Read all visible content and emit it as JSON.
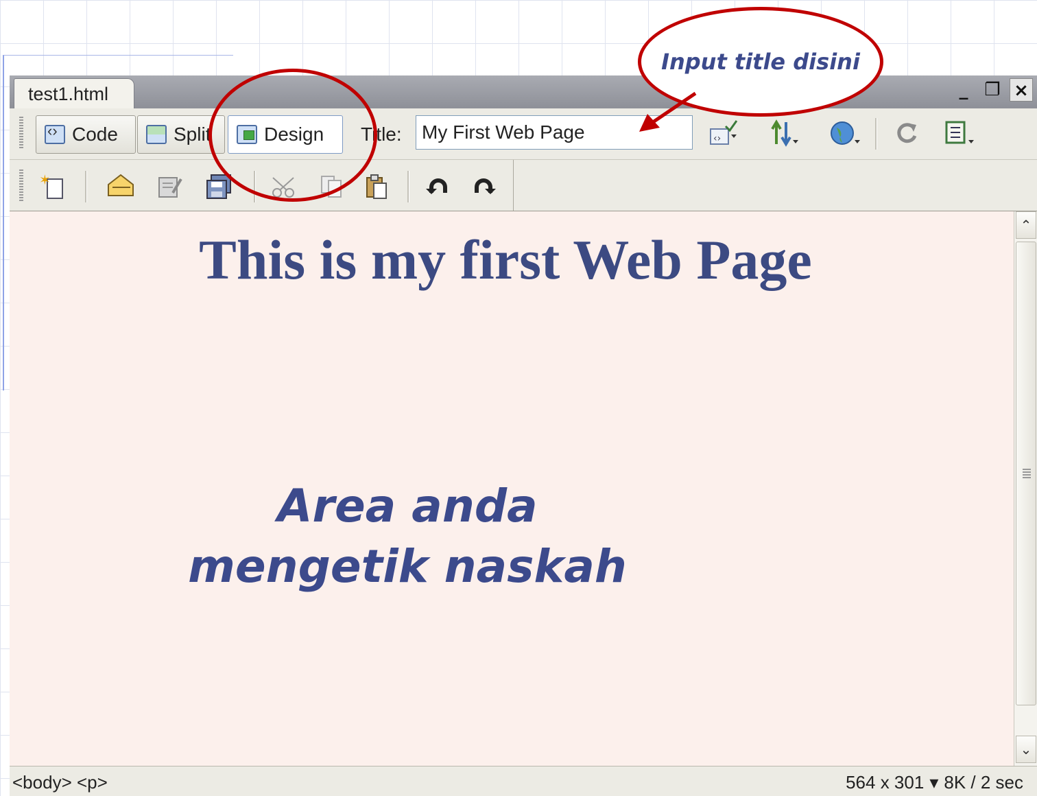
{
  "window": {
    "tab_title": "test1.html",
    "controls": {
      "minimize": "_",
      "restore": "❐",
      "close": "×"
    }
  },
  "doc_toolbar": {
    "code_label": "Code",
    "split_label": "Split",
    "design_label": "Design",
    "title_label": "Title:",
    "title_value": "My First Web Page",
    "icons": [
      "validate-markup-icon",
      "file-management-icon",
      "preview-browser-icon",
      "refresh-icon",
      "view-options-icon"
    ]
  },
  "standard_toolbar": {
    "icons": [
      "new-icon",
      "open-icon",
      "browse-bridge-icon",
      "save-icon",
      "cut-icon",
      "copy-icon",
      "paste-icon",
      "undo-icon",
      "redo-icon"
    ]
  },
  "design_view": {
    "heading": "This is my first Web Page",
    "note_line1": "Area anda",
    "note_line2": "mengetik naskah"
  },
  "status_bar": {
    "tag_selector": "<body> <p>",
    "window_size": "564 x 301",
    "size_dropdown_arrow": "▾",
    "download_stats": "8K / 2 sec"
  },
  "annotation": {
    "callout_text": "Input title disini"
  },
  "colors": {
    "annotation_red": "#c00000",
    "heading_blue": "#3c4a82",
    "design_bg": "#fcf0ec"
  }
}
